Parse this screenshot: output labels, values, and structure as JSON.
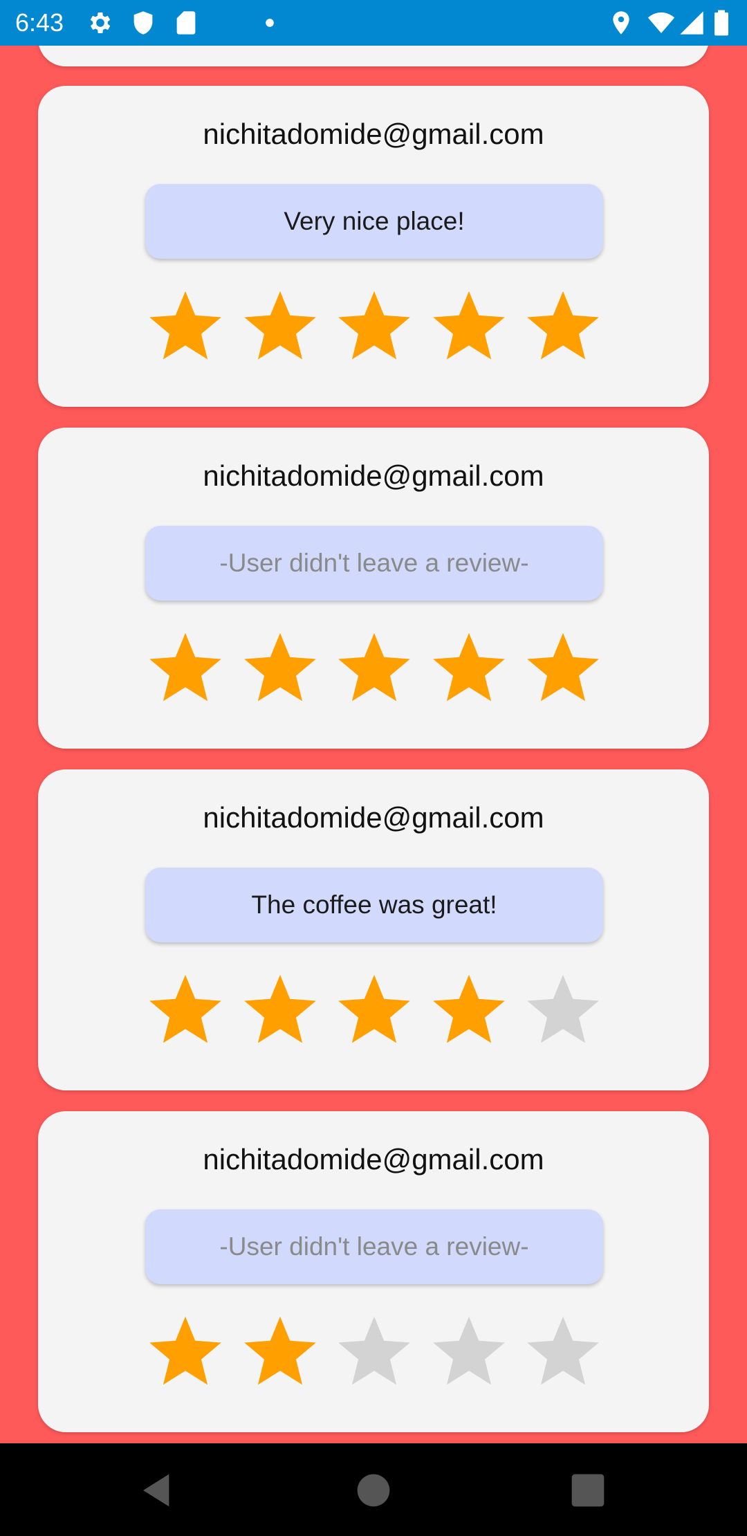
{
  "status_bar": {
    "time": "6:43",
    "icons": [
      "settings-icon",
      "shield-icon",
      "sd-card-icon",
      "dot-icon",
      "location-icon",
      "wifi-icon",
      "signal-icon",
      "battery-icon"
    ],
    "color": "#0288D1"
  },
  "theme": {
    "background": "#FF5A5A",
    "card": "#F4F4F4",
    "review_box": "#D1D9FC",
    "star_on": "#FFA000",
    "star_off": "#D3D3D3"
  },
  "reviews": [
    {
      "email": "nichitadomide@gmail.com",
      "text": "Very nice place!",
      "rating": 5
    },
    {
      "email": "nichitadomide@gmail.com",
      "text": "-User didn't leave a review-",
      "rating": 5
    },
    {
      "email": "nichitadomide@gmail.com",
      "text": "The coffee was great!",
      "rating": 4
    },
    {
      "email": "nichitadomide@gmail.com",
      "text": "-User didn't leave a review-",
      "rating": 2
    }
  ],
  "nav": {
    "buttons": [
      "back-icon",
      "home-icon",
      "recents-icon"
    ]
  }
}
